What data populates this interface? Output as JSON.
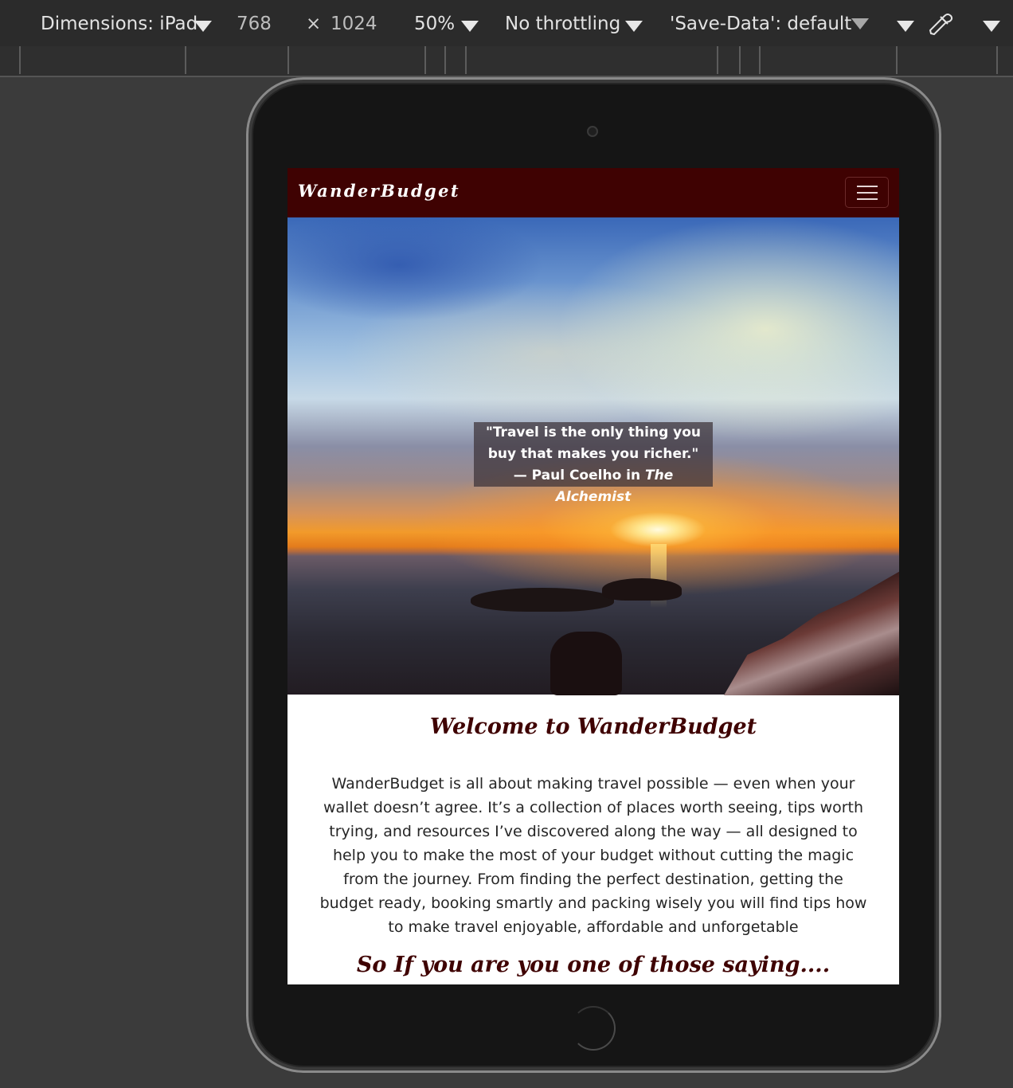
{
  "devtools": {
    "dimensions_label": "Dimensions: iPad",
    "width": "768",
    "times": "×",
    "height": "1024",
    "zoom": "50%",
    "throttling": "No throttling",
    "save_data": "'Save-Data': default"
  },
  "site": {
    "brand": "WanderBudget",
    "hero": {
      "quote": "\"Travel is the only thing you buy that makes you richer.\"",
      "attribution": "—  Paul Coelho in ",
      "book": "The Alchemist"
    },
    "welcome_title": "Welcome to WanderBudget",
    "intro": "WanderBudget is all about making travel possible — even when your wallet doesn’t agree. It’s a collection of places worth seeing, tips worth trying, and resources I’ve discovered along the way — all designed to help you to make the most of your budget without cutting the magic from the journey. From finding the perfect destination, getting the budget ready, booking smartly and packing wisely you will find tips how to make travel enjoyable, affordable and unforgetable",
    "saying_heading": "So If you are you one of those saying...."
  },
  "colors": {
    "navbar": "#3f0202",
    "heading": "#3f0202",
    "devtools_bg": "#2b2b2b"
  },
  "icons": [
    "chevron-down-icon",
    "eyedropper-icon",
    "hamburger-menu-icon",
    "camera-icon",
    "home-button-icon"
  ]
}
